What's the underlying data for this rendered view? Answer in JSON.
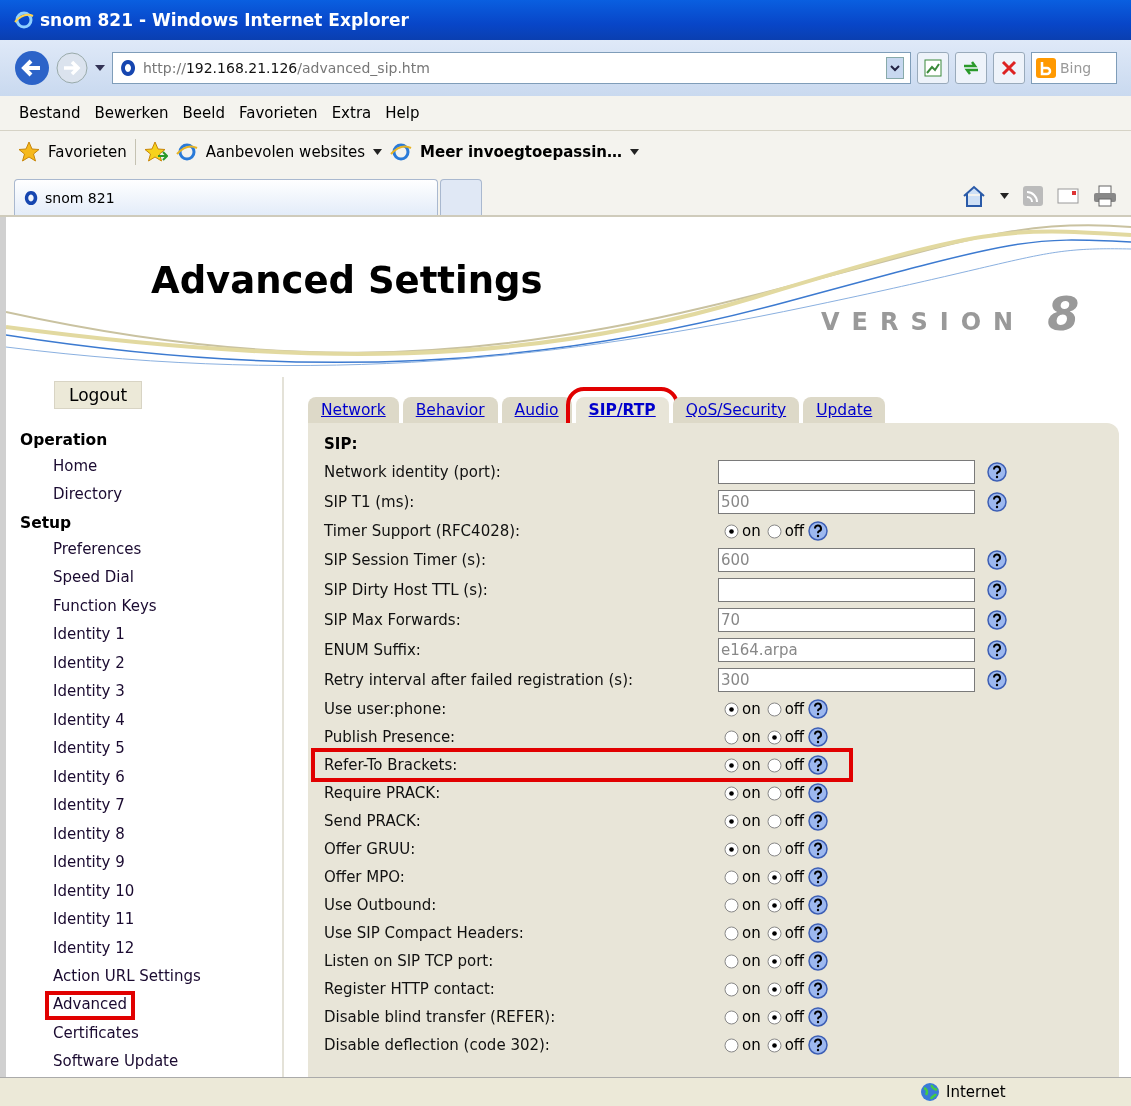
{
  "window": {
    "title": "snom 821 - Windows Internet Explorer"
  },
  "address_bar": {
    "url_prefix": "http://",
    "url_host": "192.168.21.126",
    "url_path": "/advanced_sip.htm",
    "search_placeholder": "Bing"
  },
  "menu": [
    "Bestand",
    "Bewerken",
    "Beeld",
    "Favorieten",
    "Extra",
    "Help"
  ],
  "favorites_bar": {
    "favorites": "Favorieten",
    "items": [
      {
        "label": "Aanbevolen websites",
        "bold": false
      },
      {
        "label": "Meer invoegtoepassin…",
        "bold": true
      }
    ]
  },
  "browser_tabs": [
    {
      "label": "snom 821",
      "selected": true
    }
  ],
  "page": {
    "title": "Advanced Settings",
    "version_label": "VERSION",
    "version_number": "8"
  },
  "sidebar": {
    "logout": "Logout",
    "sections": [
      {
        "heading": "Operation",
        "items": [
          {
            "label": "Home",
            "highlighted": false
          },
          {
            "label": "Directory",
            "highlighted": false
          }
        ]
      },
      {
        "heading": "Setup",
        "items": [
          {
            "label": "Preferences",
            "highlighted": false
          },
          {
            "label": "Speed Dial",
            "highlighted": false
          },
          {
            "label": "Function Keys",
            "highlighted": false
          },
          {
            "label": "Identity 1",
            "highlighted": false
          },
          {
            "label": "Identity 2",
            "highlighted": false
          },
          {
            "label": "Identity 3",
            "highlighted": false
          },
          {
            "label": "Identity 4",
            "highlighted": false
          },
          {
            "label": "Identity 5",
            "highlighted": false
          },
          {
            "label": "Identity 6",
            "highlighted": false
          },
          {
            "label": "Identity 7",
            "highlighted": false
          },
          {
            "label": "Identity 8",
            "highlighted": false
          },
          {
            "label": "Identity 9",
            "highlighted": false
          },
          {
            "label": "Identity 10",
            "highlighted": false
          },
          {
            "label": "Identity 11",
            "highlighted": false
          },
          {
            "label": "Identity 12",
            "highlighted": false
          },
          {
            "label": "Action URL Settings",
            "highlighted": false
          },
          {
            "label": "Advanced",
            "highlighted": true
          },
          {
            "label": "Certificates",
            "highlighted": false
          },
          {
            "label": "Software Update",
            "highlighted": false
          }
        ]
      }
    ]
  },
  "tabs": [
    {
      "label": "Network",
      "selected": false,
      "highlighted": false
    },
    {
      "label": "Behavior",
      "selected": false,
      "highlighted": false
    },
    {
      "label": "Audio",
      "selected": false,
      "highlighted": false
    },
    {
      "label": "SIP/RTP",
      "selected": true,
      "highlighted": true
    },
    {
      "label": "QoS/Security",
      "selected": false,
      "highlighted": false
    },
    {
      "label": "Update",
      "selected": false,
      "highlighted": false
    }
  ],
  "form": {
    "section": "SIP:",
    "rows": [
      {
        "kind": "text",
        "label": "Network identity (port):",
        "value": "",
        "highlighted": false
      },
      {
        "kind": "text",
        "label": "SIP T1 (ms):",
        "value": "500",
        "highlighted": false
      },
      {
        "kind": "toggle",
        "label": "Timer Support (RFC4028):",
        "on_label": "on",
        "off_label": "off",
        "on": true,
        "highlighted": false
      },
      {
        "kind": "text",
        "label": "SIP Session Timer (s):",
        "value": "600",
        "highlighted": false
      },
      {
        "kind": "text",
        "label": "SIP Dirty Host TTL (s):",
        "value": "",
        "highlighted": false
      },
      {
        "kind": "text",
        "label": "SIP Max Forwards:",
        "value": "70",
        "highlighted": false
      },
      {
        "kind": "text",
        "label": "ENUM Suffix:",
        "value": "e164.arpa",
        "highlighted": false
      },
      {
        "kind": "text",
        "label": "Retry interval after failed registration (s):",
        "value": "300",
        "highlighted": false
      },
      {
        "kind": "toggle",
        "label": "Use user:phone:",
        "on_label": "on",
        "off_label": "off",
        "on": true,
        "highlighted": false
      },
      {
        "kind": "toggle",
        "label": "Publish Presence:",
        "on_label": "on",
        "off_label": "off",
        "on": false,
        "highlighted": false
      },
      {
        "kind": "toggle",
        "label": "Refer-To Brackets:",
        "on_label": "on",
        "off_label": "off",
        "on": true,
        "highlighted": true
      },
      {
        "kind": "toggle",
        "label": "Require PRACK:",
        "on_label": "on",
        "off_label": "off",
        "on": true,
        "highlighted": false
      },
      {
        "kind": "toggle",
        "label": "Send PRACK:",
        "on_label": "on",
        "off_label": "off",
        "on": true,
        "highlighted": false
      },
      {
        "kind": "toggle",
        "label": "Offer GRUU:",
        "on_label": "on",
        "off_label": "off",
        "on": true,
        "highlighted": false
      },
      {
        "kind": "toggle",
        "label": "Offer MPO:",
        "on_label": "on",
        "off_label": "off",
        "on": false,
        "highlighted": false
      },
      {
        "kind": "toggle",
        "label": "Use Outbound:",
        "on_label": "on",
        "off_label": "off",
        "on": false,
        "highlighted": false
      },
      {
        "kind": "toggle",
        "label": "Use SIP Compact Headers:",
        "on_label": "on",
        "off_label": "off",
        "on": false,
        "highlighted": false
      },
      {
        "kind": "toggle",
        "label": "Listen on SIP TCP port:",
        "on_label": "on",
        "off_label": "off",
        "on": false,
        "highlighted": false
      },
      {
        "kind": "toggle",
        "label": "Register HTTP contact:",
        "on_label": "on",
        "off_label": "off",
        "on": false,
        "highlighted": false
      },
      {
        "kind": "toggle",
        "label": "Disable blind transfer (REFER):",
        "on_label": "on",
        "off_label": "off",
        "on": false,
        "highlighted": false
      },
      {
        "kind": "toggle",
        "label": "Disable deflection (code 302):",
        "on_label": "on",
        "off_label": "off",
        "on": false,
        "highlighted": false
      }
    ]
  },
  "status_bar": {
    "zone": "Internet"
  }
}
